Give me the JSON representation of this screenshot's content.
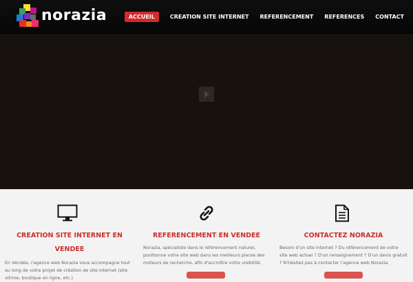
{
  "header": {
    "logo_text": "norazia",
    "nav": [
      {
        "label": "ACCUEIL",
        "active": true
      },
      {
        "label": "CREATION SITE INTERNET"
      },
      {
        "label": "REFERENCEMENT"
      },
      {
        "label": "REFERENCES"
      },
      {
        "label": "CONTACT"
      }
    ]
  },
  "services": [
    {
      "icon": "monitor-icon",
      "title_line1": "CREATION SITE INTERNET EN",
      "title_line2": "VENDEE",
      "text_lines": [
        "En Vendée, l'agence web Norazia vous accompagne tout",
        "au long de votre projet de création de site internet (site",
        "vitrine, boutique en ligne, etc.)"
      ]
    },
    {
      "icon": "link-icon",
      "title_line1": "REFERENCEMENT EN VENDEE",
      "text_lines": [
        "Norazia, spécialiste dans le référencement naturel,",
        "positionne votre site web dans les meilleurs places des",
        "moteurs de recherche, afin d'accroître votre visibilité."
      ]
    },
    {
      "icon": "document-icon",
      "title_line1": "CONTACTEZ NORAZIA",
      "text_lines": [
        "Besoin d'un site internet ? Du référencement de votre",
        "site web actuel ? D'un renseignement ? D'un devis gratuit",
        "? N'hésitez pas à contacter l'agence web Norazia."
      ]
    }
  ],
  "colors": {
    "accent": "#d12b2b",
    "title_red": "#c9302c",
    "hero_bg": "#17120d",
    "header_bg": "#0b0b0b"
  }
}
